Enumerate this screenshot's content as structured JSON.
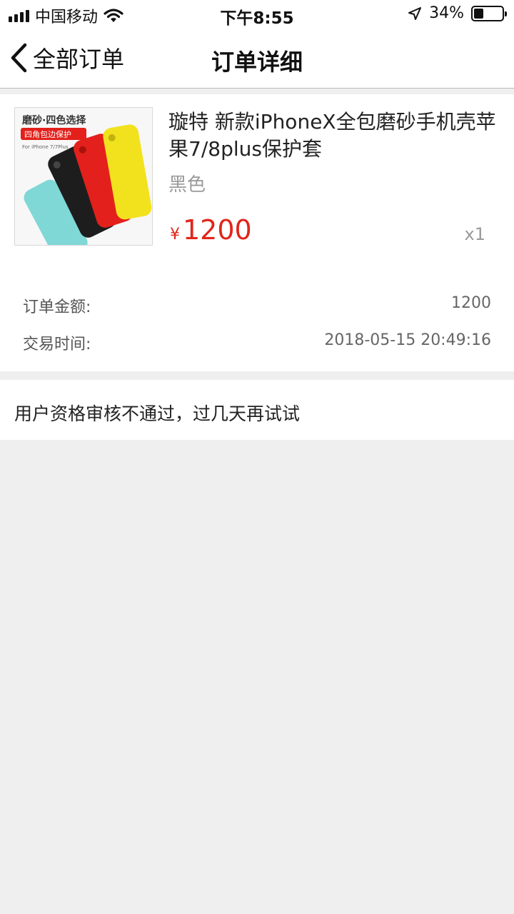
{
  "status_bar": {
    "carrier": "中国移动",
    "time": "下午8:55",
    "battery_percent": "34%",
    "battery_level": 0.34
  },
  "nav": {
    "back_label": "全部订单",
    "title": "订单详细"
  },
  "product": {
    "image": {
      "headline": "磨砂·四色选择",
      "badge": "四角包边保护",
      "model": "For iPhone 7/7Plus",
      "colors": [
        "#7fd8d6",
        "#1d1d1d",
        "#e3201b",
        "#f2e21e"
      ]
    },
    "name": "璇特 新款iPhoneX全包磨砂手机壳苹果7/8plus保护套",
    "variant": "黑色",
    "currency": "¥",
    "price": "1200",
    "quantity": "x1",
    "price_color": "#e1251b"
  },
  "order_info": [
    {
      "label": "订单金额:",
      "value": "1200"
    },
    {
      "label": "交易时间:",
      "value": "2018-05-15 20:49:16"
    }
  ],
  "message": "用户资格审核不通过，过几天再试试"
}
